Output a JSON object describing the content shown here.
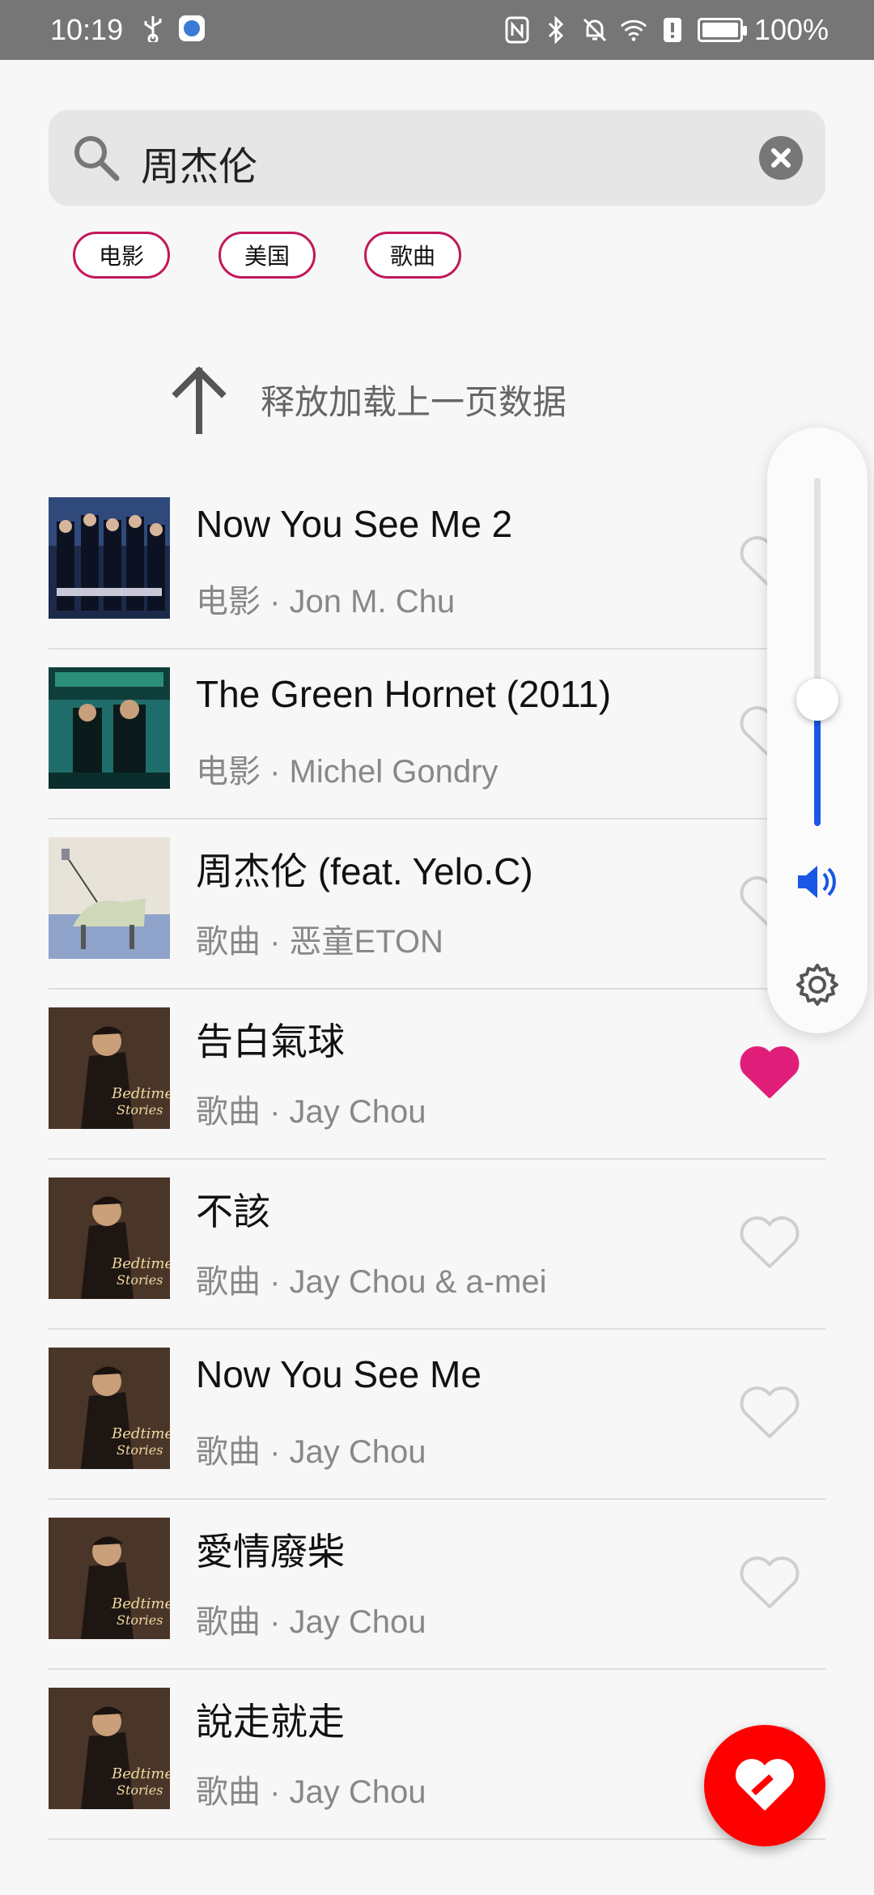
{
  "status_bar": {
    "time": "10:19",
    "battery": "100%"
  },
  "search": {
    "value": "周杰伦"
  },
  "tags": [
    "电影",
    "美国",
    "歌曲"
  ],
  "pull_refresh": {
    "text": "释放加载上一页数据"
  },
  "results": [
    {
      "title": "Now You See Me 2",
      "subtitle": "电影 · Jon M. Chu",
      "liked": false
    },
    {
      "title": "The Green Hornet (2011)",
      "subtitle": "电影 · Michel Gondry",
      "liked": false
    },
    {
      "title": "周杰伦 (feat. Yelo.C)",
      "subtitle": "歌曲 · 恶童ETON",
      "liked": false
    },
    {
      "title": "告白氣球",
      "subtitle": "歌曲 · Jay Chou",
      "liked": true
    },
    {
      "title": "不該",
      "subtitle": "歌曲 · Jay Chou & a-mei",
      "liked": false
    },
    {
      "title": "Now You See Me",
      "subtitle": "歌曲 · Jay Chou",
      "liked": false
    },
    {
      "title": "愛情廢柴",
      "subtitle": "歌曲 · Jay Chou",
      "liked": false
    },
    {
      "title": "說走就走",
      "subtitle": "歌曲 · Jay Chou",
      "liked": false
    }
  ],
  "volume": {
    "level": 0.36
  },
  "colors": {
    "accent": "#c2185b",
    "liked": "#e01e7a",
    "fab": "#ff0000",
    "volume": "#1a57e6"
  }
}
